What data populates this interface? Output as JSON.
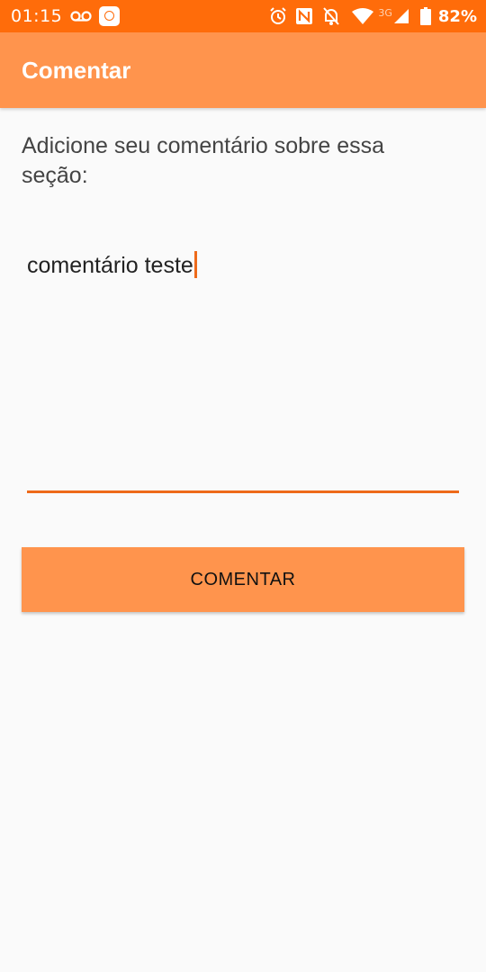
{
  "status_bar": {
    "time": "01:15",
    "network_type": "3G",
    "battery_percent": "82%",
    "icons": [
      "voicemail-icon",
      "app-notification-icon",
      "alarm-icon",
      "nfc-icon",
      "notifications-off-icon",
      "wifi-icon",
      "signal-icon",
      "battery-icon"
    ]
  },
  "app_bar": {
    "title": "Comentar"
  },
  "form": {
    "prompt": "Adicione seu comentário sobre essa seção:",
    "comment_value": "comentário teste",
    "submit_label": "COMENTAR"
  },
  "colors": {
    "status_bar": "#ff6c0a",
    "app_bar": "#ff944d",
    "accent": "#ee6a1a",
    "button": "#ff944d",
    "background": "#fafafa"
  }
}
